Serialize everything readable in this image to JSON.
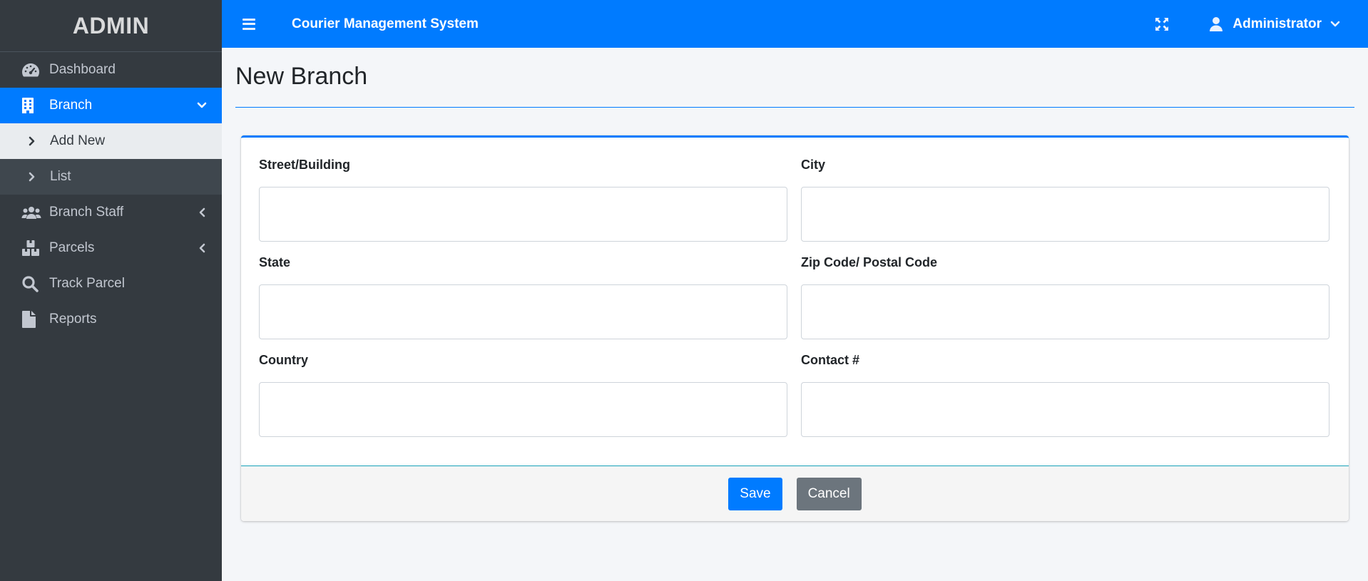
{
  "brand": {
    "title": "ADMIN"
  },
  "topbar": {
    "app_title": "Courier Management System",
    "user_name": "Administrator"
  },
  "sidebar": {
    "items": [
      {
        "label": "Dashboard",
        "icon": "dashboard-icon"
      },
      {
        "label": "Branch",
        "icon": "building-icon",
        "active": true,
        "submenu": [
          {
            "label": "Add New",
            "current": true
          },
          {
            "label": "List"
          }
        ]
      },
      {
        "label": "Branch Staff",
        "icon": "users-icon"
      },
      {
        "label": "Parcels",
        "icon": "parcels-icon"
      },
      {
        "label": "Track Parcel",
        "icon": "search-icon"
      },
      {
        "label": "Reports",
        "icon": "file-icon"
      }
    ]
  },
  "page": {
    "title": "New Branch"
  },
  "form": {
    "fields": [
      {
        "label": "Street/Building",
        "value": ""
      },
      {
        "label": "City",
        "value": ""
      },
      {
        "label": "State",
        "value": ""
      },
      {
        "label": "Zip Code/ Postal Code",
        "value": ""
      },
      {
        "label": "Country",
        "value": ""
      },
      {
        "label": "Contact #",
        "value": ""
      }
    ],
    "save_label": "Save",
    "cancel_label": "Cancel"
  },
  "colors": {
    "primary": "#007bff",
    "sidebar_bg": "#343a40",
    "secondary": "#6c757d",
    "footer_border": "#17a2b8"
  }
}
